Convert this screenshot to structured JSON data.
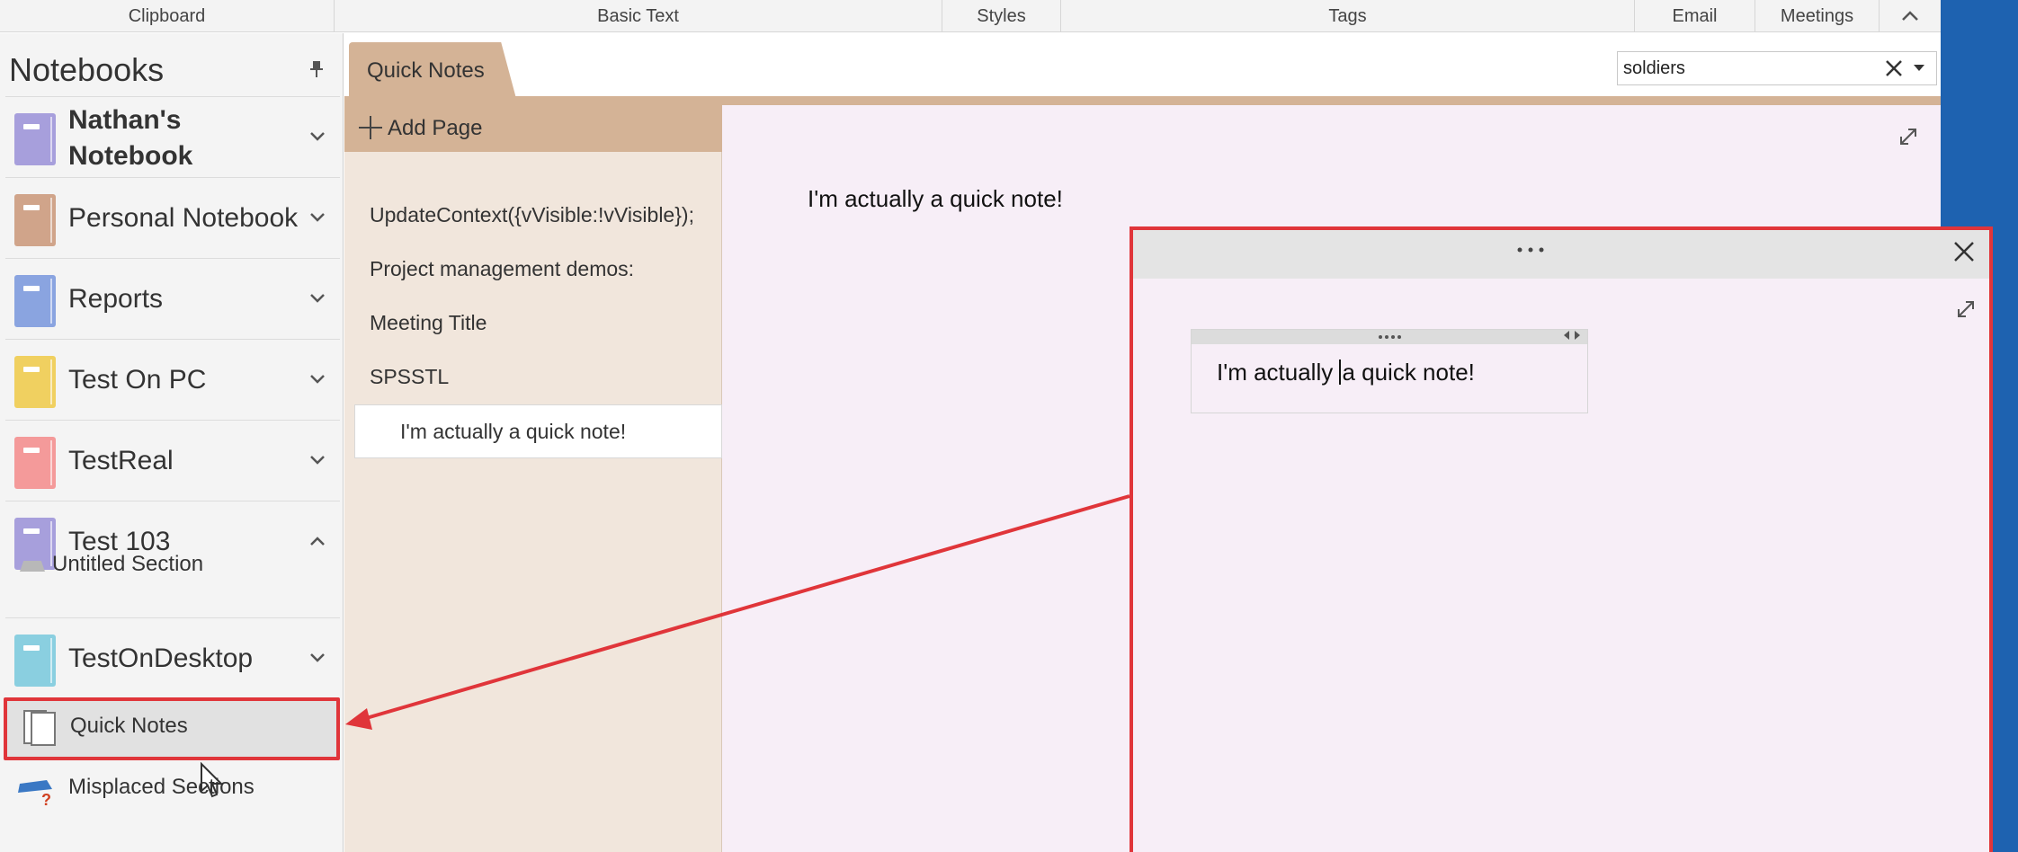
{
  "ribbon": {
    "groups": [
      "Clipboard",
      "Basic Text",
      "Styles",
      "Tags",
      "Email",
      "Meetings"
    ],
    "collapse_glyph": "^"
  },
  "nav": {
    "title": "Notebooks",
    "notebooks": [
      {
        "name": "Nathan's\nNotebook",
        "color": "#a79fdc",
        "bold": true,
        "chevron": "down"
      },
      {
        "name": "Personal Notebook",
        "color": "#d0a48a",
        "chevron": "down"
      },
      {
        "name": "Reports",
        "color": "#8aa4e0",
        "chevron": "down"
      },
      {
        "name": "Test On PC",
        "color": "#f0d060",
        "chevron": "down"
      },
      {
        "name": "TestReal",
        "color": "#f49a9a",
        "chevron": "down"
      },
      {
        "name": "Test 103",
        "color": "#a79fdc",
        "chevron": "up"
      },
      {
        "name": "TestOnDesktop",
        "color": "#8acfe0",
        "chevron": "down"
      }
    ],
    "untitled_section": "Untitled Section",
    "quick_notes": "Quick Notes",
    "misplaced_sections": "Misplaced Sections"
  },
  "section": {
    "tab_label": "Quick Notes",
    "tab_color": "#d4b396"
  },
  "search": {
    "value": "soldiers"
  },
  "pages": {
    "add_page": "Add Page",
    "items": [
      "UpdateContext({vVisible:!vVisible});",
      "Project management demos:",
      "Meeting Title",
      "SPSSTL"
    ],
    "selected": "I'm actually a quick note!"
  },
  "canvas": {
    "note": "I'm actually a quick note!"
  },
  "popup": {
    "note_before_cursor": "I'm actually ",
    "note_after_cursor": "a quick note!",
    "highlight_color": "#e0353a"
  }
}
